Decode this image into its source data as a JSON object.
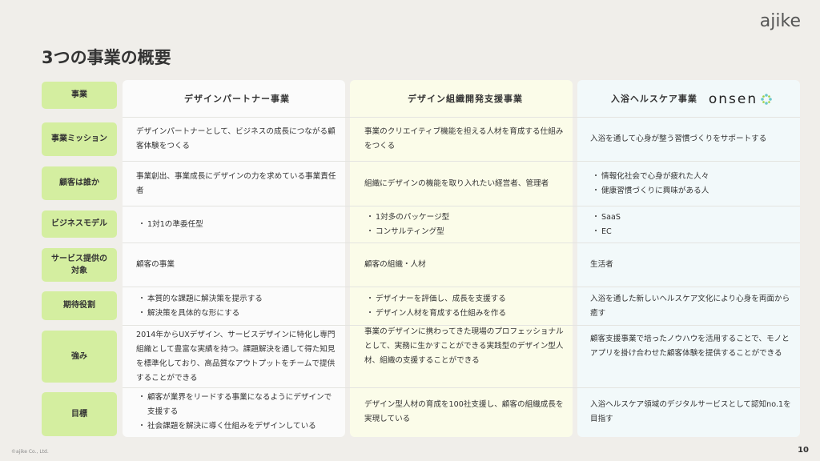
{
  "logo": "ajike",
  "title": "3つの事業の概要",
  "labels": {
    "business": "事業",
    "mission": "事業ミッション",
    "customer": "顧客は誰か",
    "model": "ビジネスモデル",
    "target": "サービス提供の対象",
    "role": "期待役割",
    "strength": "強み",
    "goal": "目標"
  },
  "columns": [
    {
      "name": "デザインパートナー事業",
      "mission": "デザインパートナーとして、ビジネスの成長につながる顧客体験をつくる",
      "customer": "事業創出、事業成長にデザインの力を求めている事業責任者",
      "model": [
        "1対1の準委任型"
      ],
      "target": "顧客の事業",
      "role": [
        "本質的な課題に解決策を提示する",
        "解決策を具体的な形にする"
      ],
      "strength": "2014年からUXデザイン、サービスデザインに特化し専門組織として豊富な実績を持つ。課題解決を通して得た知見を標準化しており、高品質なアウトプットをチームで提供することができる",
      "goal": [
        "顧客が業界をリードする事業になるようにデザインで支援する",
        "社会課題を解決に導く仕組みをデザインしている"
      ]
    },
    {
      "name": "デザイン組織開発支援事業",
      "mission": "事業のクリエイティブ機能を担える人材を育成する仕組みをつくる",
      "customer": "組織にデザインの機能を取り入れたい経営者、管理者",
      "model": [
        "1対多のパッケージ型",
        "コンサルティング型"
      ],
      "target": "顧客の組織・人材",
      "role": [
        "デザイナーを評価し、成長を支援する",
        "デザイン人材を育成する仕組みを作る"
      ],
      "strength": "事業のデザインに携わってきた現場のプロフェッショナルとして、実務に生かすことができる実践型のデザイン型人材、組織の支援することができる",
      "goal": "デザイン型人材の育成を100社支援し、顧客の組織成長を実現している"
    },
    {
      "name": "入浴ヘルスケア事業",
      "brand": "onsen",
      "mission": "入浴を通して心身が整う習慣づくりをサポートする",
      "customer": [
        "情報化社会で心身が疲れた人々",
        "健康習慣づくりに興味がある人"
      ],
      "model": [
        "SaaS",
        "EC"
      ],
      "target": "生活者",
      "role": "入浴を通した新しいヘルスケア文化により心身を両面から癒す",
      "strength": "顧客支援事業で培ったノウハウを活用することで、モノとアプリを掛け合わせた顧客体験を提供することができる",
      "goal": "入浴ヘルスケア領域のデジタルサービスとして認知no.1を目指す"
    }
  ],
  "footer": "©ajike Co., Ltd.",
  "page_number": "10",
  "colors": {
    "label_bg": "#d4eea0",
    "accent": "#9ccf3b",
    "col2_bg": "#fbfce9",
    "col3_bg": "#f2f9fa"
  }
}
